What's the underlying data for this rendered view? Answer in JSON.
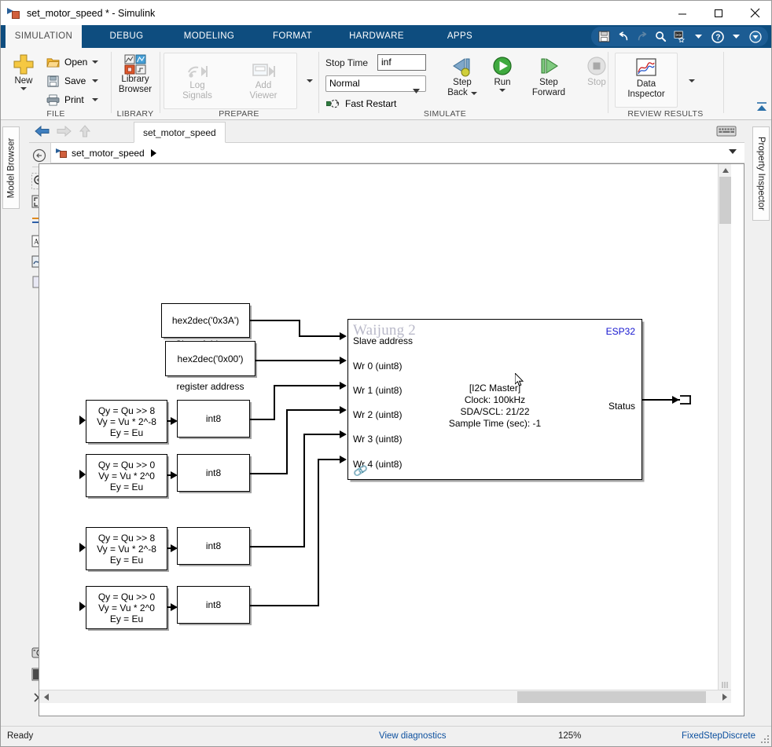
{
  "window": {
    "title": "set_motor_speed * - Simulink",
    "app_icon": "simulink-model-icon",
    "minimize": "minimize-icon",
    "maximize": "maximize-icon",
    "close": "close-icon"
  },
  "ribbon_tabs": [
    {
      "label": "SIMULATION",
      "active": true
    },
    {
      "label": "DEBUG",
      "active": false
    },
    {
      "label": "MODELING",
      "active": false
    },
    {
      "label": "FORMAT",
      "active": false
    },
    {
      "label": "HARDWARE",
      "active": false
    },
    {
      "label": "APPS",
      "active": false
    }
  ],
  "quick_access": [
    {
      "name": "save-icon"
    },
    {
      "name": "undo-icon"
    },
    {
      "name": "redo-icon"
    },
    {
      "name": "search-icon"
    },
    {
      "name": "command-favorites-icon"
    },
    {
      "name": "quick-access-dropdown-caret"
    },
    {
      "name": "help-icon"
    },
    {
      "name": "help-dropdown-caret"
    },
    {
      "name": "ribbon-collapse-icon"
    }
  ],
  "ribbon": {
    "groups": [
      {
        "label": "FILE"
      },
      {
        "label": "LIBRARY"
      },
      {
        "label": "PREPARE"
      },
      {
        "label": "SIMULATE"
      },
      {
        "label": "REVIEW RESULTS"
      }
    ],
    "file": {
      "new_label": "New",
      "open_label": "Open",
      "save_label": "Save",
      "print_label": "Print"
    },
    "library": {
      "line1": "Library",
      "line2": "Browser"
    },
    "prepare": {
      "log_signals_line1": "Log",
      "log_signals_line2": "Signals",
      "add_viewer_line1": "Add",
      "add_viewer_line2": "Viewer"
    },
    "simulate": {
      "stop_time_label": "Stop Time",
      "stop_time_value": "inf",
      "mode_value": "Normal",
      "fast_restart_label": "Fast Restart",
      "step_back_line1": "Step",
      "step_back_line2": "Back",
      "run_label": "Run",
      "step_forward_line1": "Step",
      "step_forward_line2": "Forward",
      "stop_label": "Stop"
    },
    "review": {
      "data_inspector_line1": "Data",
      "data_inspector_line2": "Inspector"
    }
  },
  "model_toolbar": {
    "back_icon": "back-arrow-icon",
    "forward_icon": "forward-arrow-icon",
    "up_icon": "up-arrow-icon",
    "document_tab": "set_motor_speed",
    "keyboard_icon": "keyboard-icon"
  },
  "breadcrumb": {
    "model_name": "set_motor_speed",
    "icon": "simulink-model-icon",
    "separator": "play-arrow-icon",
    "dropdown": "chevron-down-icon"
  },
  "side_tabs": {
    "left": "Model Browser",
    "right": "Property Inspector"
  },
  "canvas_toolbar": [
    {
      "name": "navigate-up-icon"
    },
    {
      "name": "zoom-in-icon"
    },
    {
      "name": "fit-to-view-icon"
    },
    {
      "name": "signal-highlight-icon"
    },
    {
      "name": "annotation-icon"
    },
    {
      "name": "scope-viewer-icon"
    },
    {
      "name": "area-rectangle-icon"
    },
    {
      "name": "camera-snapshot-icon"
    },
    {
      "name": "layout-panel-icon"
    },
    {
      "name": "more-tools-icon"
    }
  ],
  "canvas_bottom_icons": [
    {
      "name": "signal-plot-icon"
    }
  ],
  "diagram": {
    "constants": [
      {
        "text": "hex2dec('0x3A')",
        "label": "Slave Address"
      },
      {
        "text": "hex2dec('0x00')",
        "label": "register address"
      }
    ],
    "shift_blocks": [
      {
        "line1": "Qy = Qu >> 8",
        "line2": "Vy = Vu * 2^-8",
        "line3": "Ey = Eu"
      },
      {
        "line1": "Qy = Qu >> 0",
        "line2": "Vy = Vu * 2^0",
        "line3": "Ey = Eu"
      },
      {
        "line1": "Qy = Qu >> 8",
        "line2": "Vy = Vu * 2^-8",
        "line3": "Ey = Eu"
      },
      {
        "line1": "Qy = Qu >> 0",
        "line2": "Vy = Vu * 2^0",
        "line3": "Ey = Eu"
      }
    ],
    "cast_blocks": [
      {
        "text": "int8"
      },
      {
        "text": "int8"
      },
      {
        "text": "int8"
      },
      {
        "text": "int8"
      }
    ],
    "i2c_block": {
      "watermark": "Waijung 2",
      "target": "ESP32",
      "inputs": [
        "Slave address",
        "Wr 0 (uint8)",
        "Wr 1 (uint8)",
        "Wr 2 (uint8)",
        "Wr 3 (uint8)",
        "Wr 4 (uint8)"
      ],
      "output": "Status",
      "center_line1": "[I2C Master]",
      "center_line2": "Clock: 100kHz",
      "center_line3": "SDA/SCL: 21/22",
      "center_line4": "Sample Time (sec): -1"
    },
    "terminator": "terminator-block"
  },
  "status_bar": {
    "ready": "Ready",
    "diagnostics": "View diagnostics",
    "zoom": "125%",
    "solver": "FixedStepDiscrete"
  },
  "colors": {
    "ribbon_blue": "#0e4d7f",
    "link_blue": "#0b4f9e",
    "esp_blue": "#1414cf",
    "watermark": "#b9b9c9"
  }
}
